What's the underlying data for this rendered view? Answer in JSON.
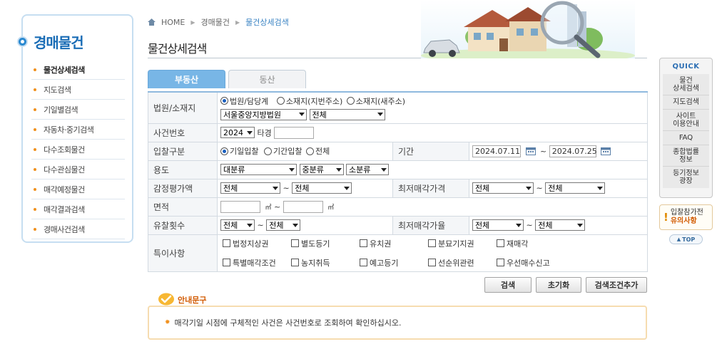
{
  "colors": {
    "accent": "#1a6db6",
    "tab_active": "#78b6e6",
    "bullet": "#f0901d",
    "notice_border": "#f6dcb0"
  },
  "sidebar": {
    "title": "경매물건",
    "items": [
      {
        "label": "물건상세검색"
      },
      {
        "label": "지도검색"
      },
      {
        "label": "기일별검색"
      },
      {
        "label": "자동차·중기검색"
      },
      {
        "label": "다수조회물건"
      },
      {
        "label": "다수관심물건"
      },
      {
        "label": "매각예정물건"
      },
      {
        "label": "매각결과검색"
      },
      {
        "label": "경매사건검색"
      }
    ]
  },
  "breadcrumb": {
    "home": "HOME",
    "level1": "경매물건",
    "current": "물건상세검색"
  },
  "page_title": "물건상세검색",
  "tabs": [
    {
      "label": "부동산"
    },
    {
      "label": "동산"
    }
  ],
  "form": {
    "court": {
      "label": "법원/소재지",
      "radio1": "법원/담당계",
      "radio2": "소재지(지번주소)",
      "radio3": "소재지(새주소)",
      "court_select": "서울중앙지방법원",
      "dept_select": "전체"
    },
    "case_no": {
      "label": "사건번호",
      "year": "2024",
      "type": "타경",
      "number": ""
    },
    "bid_type": {
      "label": "입찰구분",
      "radio1": "기일입찰",
      "radio2": "기간입찰",
      "radio3": "전체",
      "period_label": "기간",
      "date_from": "2024.07.11",
      "tilde": "~",
      "date_to": "2024.07.25"
    },
    "usage": {
      "label": "용도",
      "large": "대분류",
      "mid": "중분류",
      "small": "소분류"
    },
    "appraisal": {
      "label": "감정평가액",
      "from": "전체",
      "to": "전체",
      "min_label": "최저매각가격",
      "min_from": "전체",
      "min_to": "전체"
    },
    "area": {
      "label": "면적",
      "unit": "㎡"
    },
    "fail_count": {
      "label": "유찰횟수",
      "from": "전체",
      "to": "전체",
      "rate_label": "최저매각가율",
      "rate_from": "전체",
      "rate_to": "전체"
    },
    "special": {
      "label": "특이사항",
      "items": [
        "법정지상권",
        "별도등기",
        "유치권",
        "분묘기지권",
        "재매각",
        "특별매각조건",
        "농지취득",
        "예고등기",
        "선순위관련",
        "우선매수신고"
      ]
    }
  },
  "buttons": {
    "search": "검색",
    "reset": "초기화",
    "add_condition": "검색조건추가"
  },
  "notice": {
    "title": "안내문구",
    "text": "매각기일 시점에 구체적인 사건은 사건번호로 조회하여 확인하십시오."
  },
  "quick": {
    "title": "QUICK",
    "items": [
      {
        "line1": "물건",
        "line2": "상세검색"
      },
      {
        "line1": "지도검색",
        "line2": ""
      },
      {
        "line1": "사이트",
        "line2": "이용안내"
      },
      {
        "line1": "FAQ",
        "line2": ""
      },
      {
        "line1": "종합법률",
        "line2": "정보"
      },
      {
        "line1": "등기정보",
        "line2": "광장"
      }
    ],
    "warn_line1": "입찰참가전",
    "warn_line2": "유의사항",
    "top": "TOP"
  }
}
